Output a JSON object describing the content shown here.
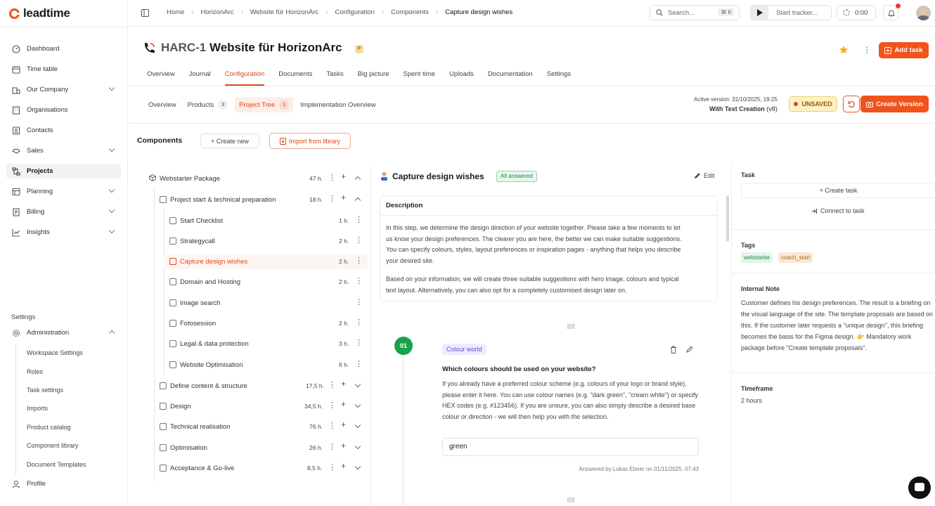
{
  "app": {
    "logo": "leadtime"
  },
  "sidebar": {
    "items": [
      {
        "label": "Dashboard"
      },
      {
        "label": "Time table"
      },
      {
        "label": "Our Company"
      },
      {
        "label": "Organisations"
      },
      {
        "label": "Contacts"
      },
      {
        "label": "Sales"
      },
      {
        "label": "Projects"
      },
      {
        "label": "Planning"
      },
      {
        "label": "Billing"
      },
      {
        "label": "Insights"
      }
    ],
    "settings_title": "Settings",
    "administration": "Administration",
    "admin_items": [
      "Workspace Settings",
      "Roles",
      "Task settings",
      "Imports",
      "Product catalog",
      "Component library",
      "Document Templates"
    ],
    "profile": "Profile"
  },
  "topbar": {
    "breadcrumbs": [
      "Home",
      "HorizonArc",
      "Website für HorizonArc",
      "Configuration",
      "Components",
      "Capture design wishes"
    ],
    "search_placeholder": "Search...",
    "search_shortcut": "⌘ K",
    "tracker_placeholder": "Start tracker...",
    "timer": "0:00"
  },
  "project": {
    "code": "HARC-1",
    "name": "Website für HorizonArc",
    "badge": "P",
    "add_task": "Add task",
    "tabs": [
      "Overview",
      "Journal",
      "Configuration",
      "Documents",
      "Tasks",
      "Big picture",
      "Spent time",
      "Uploads",
      "Documentation",
      "Settings"
    ],
    "subtabs": [
      {
        "label": "Overview",
        "count": ""
      },
      {
        "label": "Products",
        "count": "3"
      },
      {
        "label": "Project Tree",
        "count": "1"
      },
      {
        "label": "Implementation Overview",
        "count": ""
      }
    ],
    "active_version_label": "Active version:",
    "active_version_date": "31/10/2025, 19:25",
    "active_version_name": "With Text Creation",
    "active_version_num": "(v8)",
    "unsaved": "UNSAVED",
    "create_version": "Create Version"
  },
  "components": {
    "title": "Components",
    "create_new": "+ Create new",
    "import": "Import from library",
    "tree": [
      {
        "label": "Webstarter Package",
        "hours": "47 h."
      },
      {
        "label": "Project start & technical preparation",
        "hours": "18 h."
      },
      {
        "label": "Start Checklist",
        "hours": "1 h."
      },
      {
        "label": "Strategycall",
        "hours": "2 h."
      },
      {
        "label": "Capture design wishes",
        "hours": "2 h."
      },
      {
        "label": "Domain and Hosting",
        "hours": "2 h."
      },
      {
        "label": "Image search",
        "hours": ""
      },
      {
        "label": "Fotosession",
        "hours": "2 h."
      },
      {
        "label": "Legal & data protection",
        "hours": "3 h."
      },
      {
        "label": "Website Optimisation",
        "hours": "6 h."
      },
      {
        "label": "Define content & structure",
        "hours": "17,5 h."
      },
      {
        "label": "Design",
        "hours": "34,5 h."
      },
      {
        "label": "Technical realisation",
        "hours": "76 h."
      },
      {
        "label": "Optimisation",
        "hours": "26 h."
      },
      {
        "label": "Acceptance & Go-live",
        "hours": "8,5 h."
      }
    ]
  },
  "detail": {
    "title": "Capture design wishes",
    "status": "All answered",
    "edit": "Edit",
    "description_title": "Description",
    "description_p1_lines": [
      "In this step, we determine the design direction of your website together. Please take a few moments to let",
      "us know your design preferences. The clearer you are here, the better we can make suitable suggestions.",
      "You can specify colours, styles, layout preferences or inspiration pages - anything that helps you describe",
      "your desired site."
    ],
    "description_p2_lines": [
      "Based on your information, we will create three suitable suggestions with hero image, colours and typical",
      "text layout. Alternatively, you can also opt for a completely customised design later on."
    ],
    "question": {
      "number": "01",
      "category": "Colour world",
      "title": "Which colours should be used on your website?",
      "text": "If you already have a preferred colour scheme (e.g. colours of your logo or brand style), please enter it here. You can use colour names (e.g. \"dark green\", \"cream white\") or specify HEX codes (e.g. #123456). If you are unsure, you can also simply describe a desired base colour or direction - we will then help you with the selection.",
      "answer": "green",
      "answered_by": "Answered by Lukas Ebner on 01/11/2025, 07:43"
    }
  },
  "right_panel": {
    "task_label": "Task",
    "create_task": "+ Create task",
    "connect_task": "Connect to task",
    "tags_label": "Tags",
    "tags": [
      "webstarter",
      "coach_start"
    ],
    "internal_note_label": "Internal Note",
    "internal_note": "Customer defines his design preferences. The result is a briefing on the visual language of the site. The template proposals are based on this. If the customer later requests a \"unique design\", this briefing becomes the basis for the Figma design. 👉 Mandatory work package before \"Create template proposals\".",
    "timeframe_label": "Timeframe",
    "timeframe": "2 hours"
  },
  "colors": {
    "accent": "#f0531c",
    "success": "#17a34a",
    "unsaved_bg": "#fdf1c7"
  }
}
